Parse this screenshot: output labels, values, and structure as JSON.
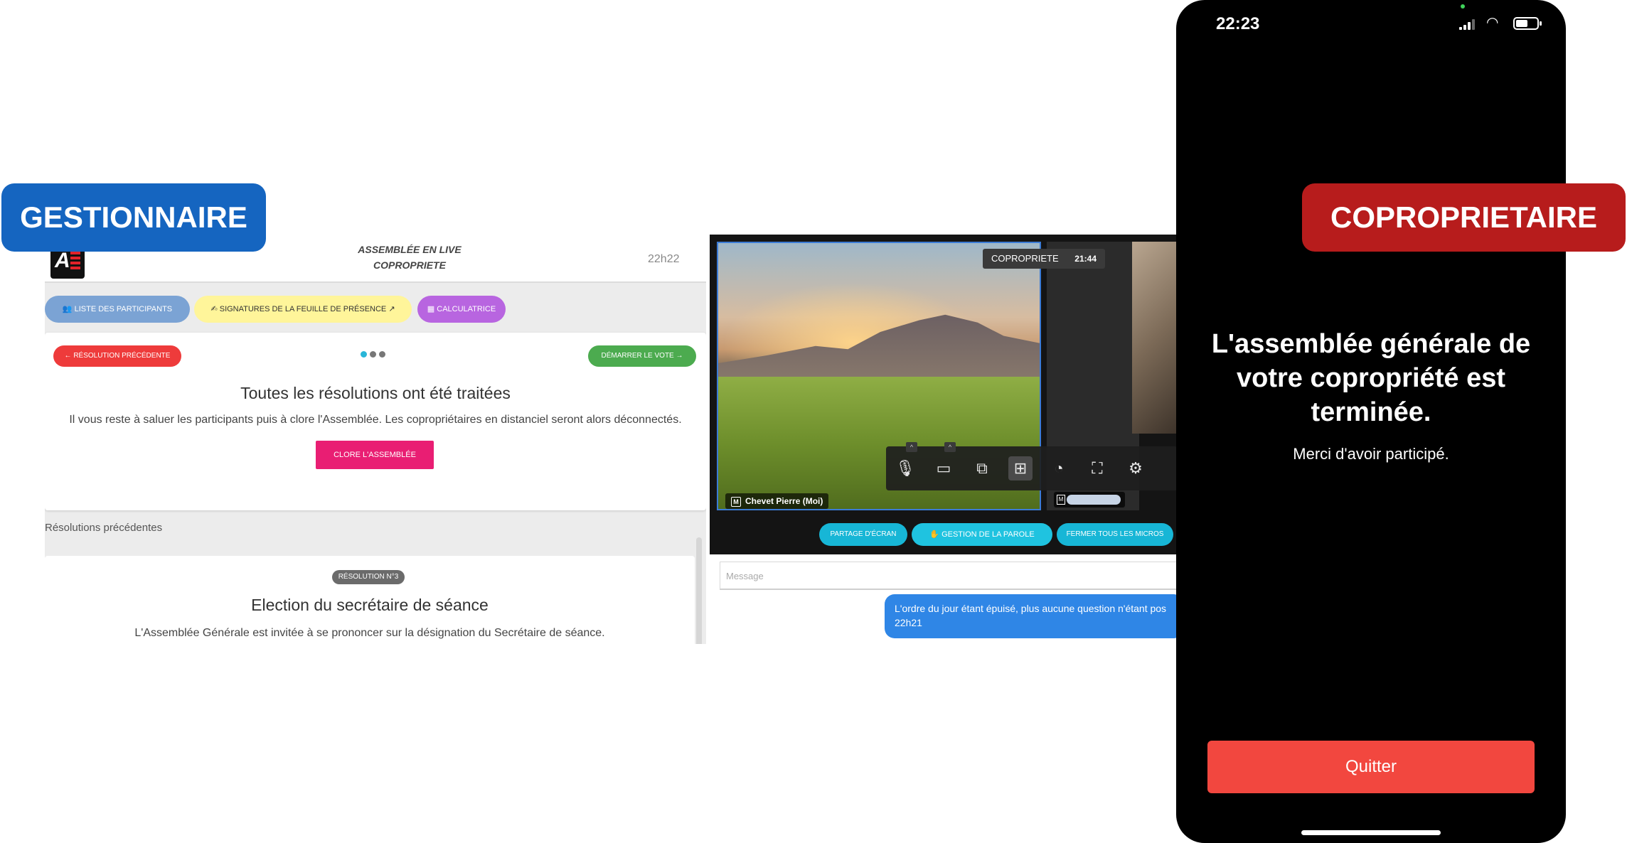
{
  "labels": {
    "manager": "GESTIONNAIRE",
    "owner": "COPROPRIETAIRE",
    "colors": {
      "manager": "#1565c0",
      "owner": "#b71c1c"
    }
  },
  "manager_app": {
    "header": {
      "title_line1": "ASSEMBLÉE EN LIVE",
      "title_line2": "COPROPRIETE",
      "time": "22h22"
    },
    "tools": {
      "participants": "LISTE DES PARTICIPANTS",
      "signatures": "SIGNATURES DE LA FEUILLE DE PRÉSENCE",
      "calculator": "CALCULATRICE"
    },
    "resolution_card": {
      "prev_button": "RÉSOLUTION PRÉCÉDENTE",
      "vote_button": "DÉMARRER LE VOTE",
      "title": "Toutes les résolutions ont été traitées",
      "subtitle": "Il vous reste à saluer les participants puis à clore l'Assemblée. Les copropriétaires en distanciel seront alors déconnectés.",
      "close_button": "CLORE L'ASSEMBLÉE"
    },
    "previous": {
      "section_label": "Résolutions précédentes",
      "badge": "RÉSOLUTION N°3",
      "title": "Election du secrétaire de séance",
      "subtitle": "L'Assemblée Générale est invitée à se prononcer sur la désignation du Secrétaire de séance."
    }
  },
  "video_panel": {
    "room_name": "COPROPRIETE",
    "room_clock": "21:44",
    "self_badge": "M",
    "self_name": "Chevet Pierre (Moi)",
    "other_badge": "M",
    "actions": {
      "share": "PARTAGE D'ÉCRAN",
      "floor": "GESTION DE LA PAROLE",
      "mute_all": "FERMER TOUS LES MICROS"
    },
    "message_placeholder": "Message",
    "chat_message": "L'ordre du jour étant épuisé, plus aucune question n'étant pos",
    "chat_time": "22h21"
  },
  "phone": {
    "time": "22:23",
    "title": "L'assemblée générale de votre copropriété est terminée.",
    "subtitle": "Merci d'avoir participé.",
    "quit_button": "Quitter",
    "accent": "#f2473f"
  }
}
